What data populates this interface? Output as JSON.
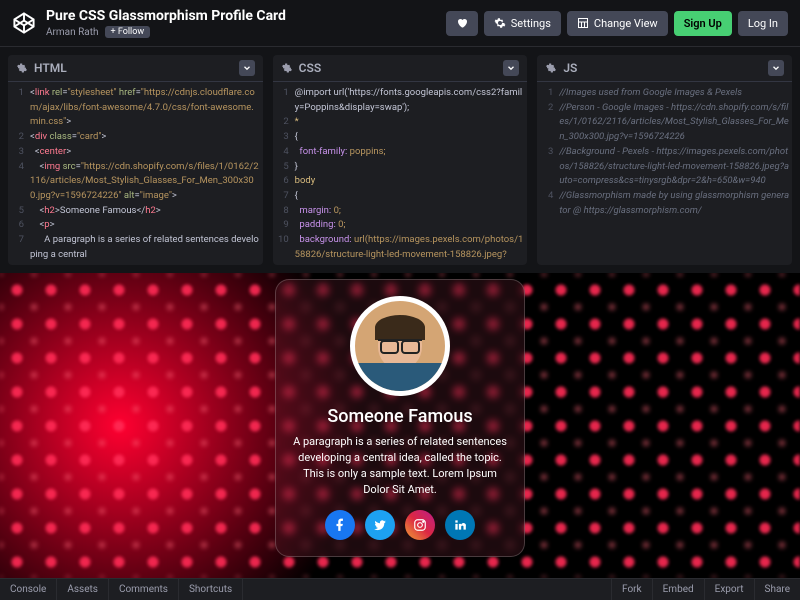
{
  "header": {
    "title": "Pure CSS Glassmorphism Profile Card",
    "author": "Arman Rath",
    "follow_label": "+ Follow",
    "actions": {
      "settings": "Settings",
      "change_view": "Change View",
      "signup": "Sign Up",
      "login": "Log In"
    }
  },
  "editors": {
    "html_label": "HTML",
    "css_label": "CSS",
    "js_label": "JS"
  },
  "html_code": [
    {
      "n": "1",
      "pre": "<",
      "tag": "link",
      "attrs": " rel=\"stylesheet\" href=\"https://cdnjs.cloudflare.com/ajax/libs/font-awesome/4.7.0/css/font-awesome.min.css\"",
      "post": ">"
    },
    {
      "n": "2",
      "pre": "<",
      "tag": "div",
      "attrs": " class=\"card\"",
      "post": ">"
    },
    {
      "n": "3",
      "pre": "  <",
      "tag": "center",
      "attrs": "",
      "post": ">"
    },
    {
      "n": "4",
      "pre": "    <",
      "tag": "img",
      "attrs": " src=\"https://cdn.shopify.com/s/files/1/0162/2116/articles/Most_Stylish_Glasses_For_Men_300x300.jpg?v=1596724226\" alt=\"image\"",
      "post": ">"
    },
    {
      "n": "5",
      "pre": "    <",
      "tag": "h2",
      "attrs": "",
      "mid": "Someone Famous",
      "ctag": "h2",
      "post": ">"
    },
    {
      "n": "6",
      "pre": "    <",
      "tag": "p",
      "attrs": "",
      "post": ">"
    },
    {
      "n": "7",
      "plain": "      A paragraph is a series of related sentences developing a central"
    }
  ],
  "css_code": [
    {
      "n": "1",
      "raw": "@import url('https://fonts.googleapis.com/css2?family=Poppins&display=swap');"
    },
    {
      "n": "2",
      "sel": "*"
    },
    {
      "n": "3",
      "raw": "{"
    },
    {
      "n": "4",
      "prop": "  font-family:",
      "val": " poppins;"
    },
    {
      "n": "5",
      "raw": "}"
    },
    {
      "n": "6",
      "sel": "body"
    },
    {
      "n": "7",
      "raw": "{"
    },
    {
      "n": "8",
      "prop": "  margin:",
      "val": " 0;"
    },
    {
      "n": "9",
      "prop": "  padding:",
      "val": " 0;"
    },
    {
      "n": "10",
      "prop": "  background:",
      "val": " url(https://images.pexels.com/photos/158826/structure-light-led-movement-158826.jpeg?"
    }
  ],
  "js_code": [
    {
      "n": "1",
      "c": "//Images used from Google Images & Pexels"
    },
    {
      "n": "2",
      "c": "//Person - Google Images - https://cdn.shopify.com/s/files/1/0162/2116/articles/Most_Stylish_Glasses_For_Men_300x300.jpg?v=1596724226"
    },
    {
      "n": "3",
      "c": "//Background - Pexels - https://images.pexels.com/photos/158826/structure-light-led-movement-158826.jpeg?auto=compress&cs=tinysrgb&dpr=2&h=650&w=940"
    },
    {
      "n": "4",
      "c": "//Glassmorphism made by using glassmorphism generator @ https://glassmorphism.com/"
    }
  ],
  "preview": {
    "name": "Someone Famous",
    "paragraph": "A paragraph is a series of related sentences developing a central idea, called the topic. This is only a sample text. Lorem Ipsum Dolor Sit Amet."
  },
  "footer": {
    "left": [
      "Console",
      "Assets",
      "Comments",
      "Shortcuts"
    ],
    "right": [
      "Fork",
      "Embed",
      "Export",
      "Share"
    ]
  }
}
